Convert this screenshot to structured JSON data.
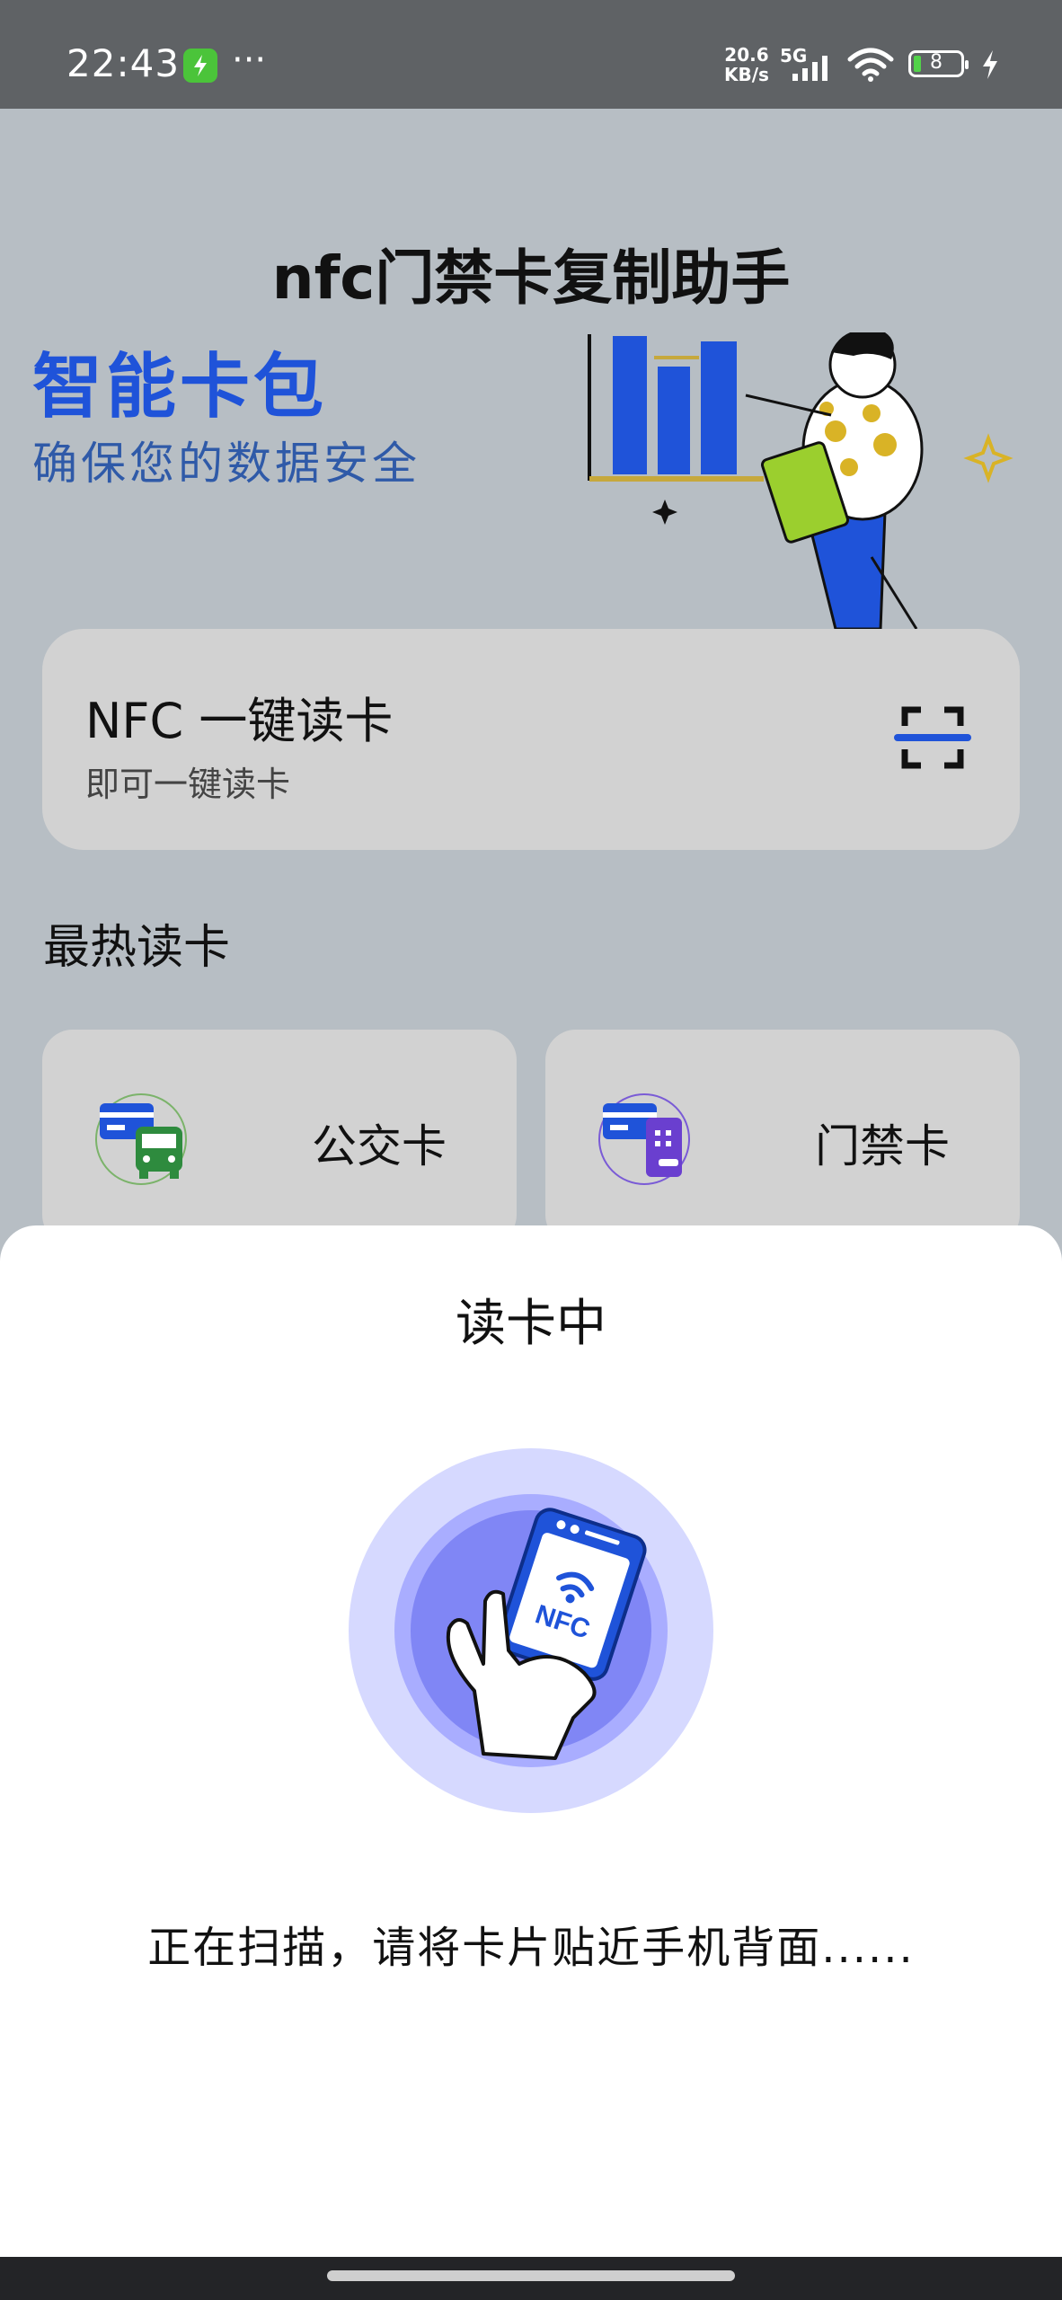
{
  "status_bar": {
    "time": "22:43",
    "more": "···",
    "speed_value": "20.6",
    "speed_unit": "KB/s",
    "network": "5G",
    "battery": "8"
  },
  "app": {
    "title": "nfc门禁卡复制助手"
  },
  "hero": {
    "title": "智能卡包",
    "subtitle": "确保您的数据安全"
  },
  "read_card": {
    "title": "NFC 一键读卡",
    "subtitle": "即可一键读卡",
    "icon": "scan-icon"
  },
  "hot": {
    "section_title": "最热读卡",
    "items": [
      {
        "label": "公交卡",
        "icon": "bus-card-icon"
      },
      {
        "label": "门禁卡",
        "icon": "door-card-icon"
      }
    ]
  },
  "sheet": {
    "title": "读卡中",
    "message": "正在扫描，请将卡片贴近手机背面......",
    "badge_text": "NFC"
  },
  "colors": {
    "brand_blue": "#1f53d9",
    "background": "#b7bec4",
    "card": "#d2d2d2",
    "nfc_ring_outer": "#d6d9ff",
    "nfc_ring_inner": "#8086f5"
  }
}
